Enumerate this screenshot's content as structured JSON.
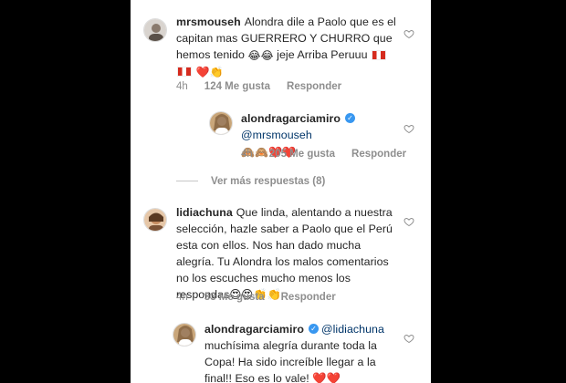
{
  "comments": [
    {
      "username": "mrsmouseh",
      "text": "Alondra dile a Paolo que es el capitan mas GUERRERO Y CHURRO que hemos tenido 😂😂 jeje Arriba Peruuu",
      "emoji_tail": "❤️👏",
      "time": "4h",
      "likes": "124 Me gusta",
      "reply": "Responder"
    },
    {
      "username": "alondragarciamiro",
      "mention": "@mrsmouseh",
      "emoji": "🙈🙈❤️❤️",
      "time": "4h",
      "likes": "205 Me gusta",
      "reply": "Responder"
    },
    {
      "username": "lidiachuna",
      "text": "Que linda, alentando a nuestra selección, hazle saber a Paolo que el Perú esta con ellos. Nos han dado mucha alegría. Tu Alondra los malos comentarios no los escuches mucho menos los respondas😍😍👏👏",
      "time": "4h",
      "likes": "33 Me gusta",
      "reply": "Responder"
    },
    {
      "username": "alondragarciamiro",
      "mention": "@lidiachuna",
      "text": "muchísima alegría durante toda la Copa! Ha sido increíble llegar a la final!! Eso es lo vale! ❤️❤️"
    }
  ],
  "view_more": "Ver más respuestas (8)",
  "icons": {
    "like": "heart-outline-icon",
    "verified": "verified-badge-icon"
  },
  "colors": {
    "text": "#262626",
    "meta": "#8e8e8e",
    "verified": "#3897f0",
    "mention": "#003569"
  }
}
